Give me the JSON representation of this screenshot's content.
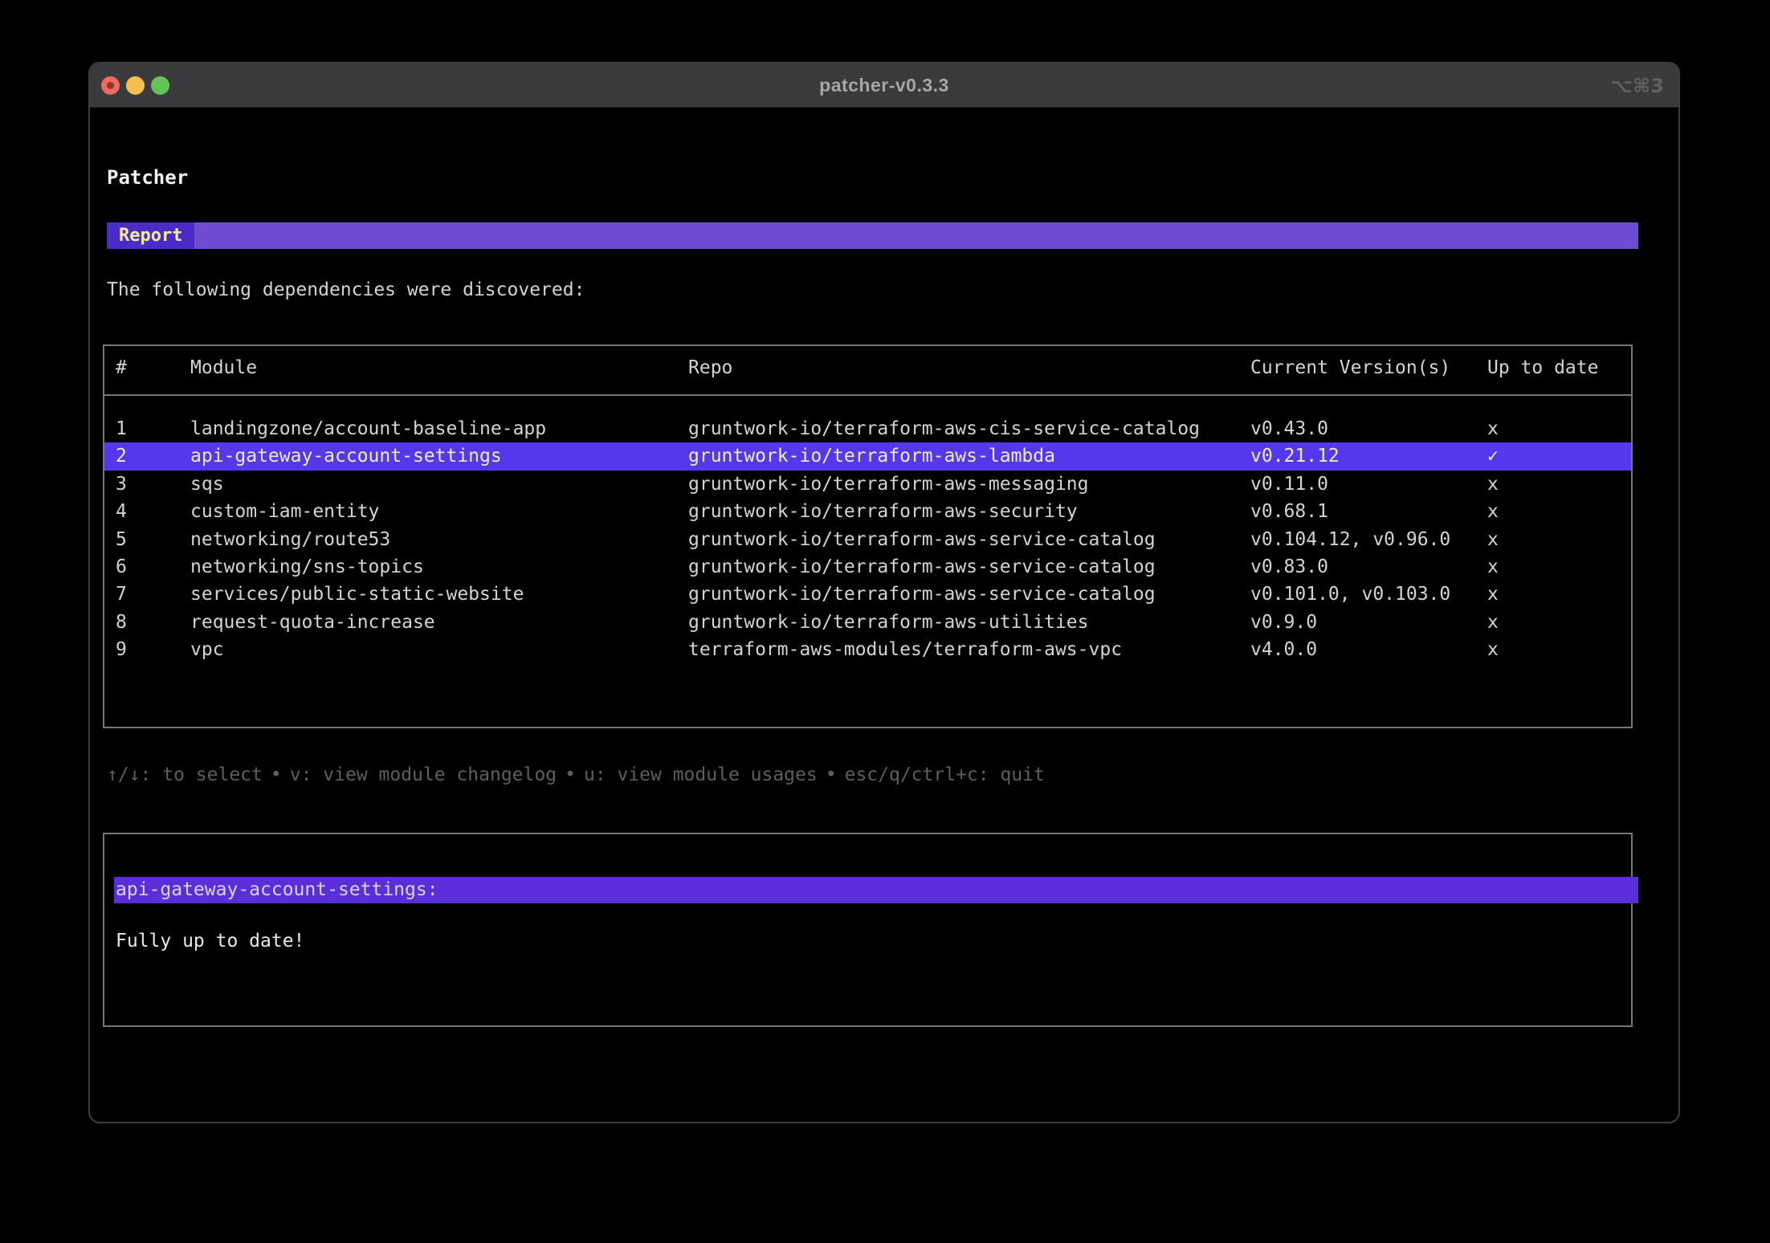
{
  "window": {
    "title": "patcher-v0.3.3",
    "shortcut": "⌥⌘3",
    "controls": [
      "close",
      "minimize",
      "zoom"
    ]
  },
  "app": {
    "heading": "Patcher",
    "active_tab": "Report",
    "intro": "The following dependencies were discovered:"
  },
  "table": {
    "columns": [
      "#",
      "Module",
      "Repo",
      "Current Version(s)",
      "Up to date"
    ],
    "rows": [
      {
        "num": "1",
        "module": "landingzone/account-baseline-app",
        "repo": "gruntwork-io/terraform-aws-cis-service-catalog",
        "versions": "v0.43.0",
        "up_to_date": "x",
        "selected": false
      },
      {
        "num": "2",
        "module": "api-gateway-account-settings",
        "repo": "gruntwork-io/terraform-aws-lambda",
        "versions": "v0.21.12",
        "up_to_date": "✓",
        "selected": true
      },
      {
        "num": "3",
        "module": "sqs",
        "repo": "gruntwork-io/terraform-aws-messaging",
        "versions": "v0.11.0",
        "up_to_date": "x",
        "selected": false
      },
      {
        "num": "4",
        "module": "custom-iam-entity",
        "repo": "gruntwork-io/terraform-aws-security",
        "versions": "v0.68.1",
        "up_to_date": "x",
        "selected": false
      },
      {
        "num": "5",
        "module": "networking/route53",
        "repo": "gruntwork-io/terraform-aws-service-catalog",
        "versions": "v0.104.12, v0.96.0",
        "up_to_date": "x",
        "selected": false
      },
      {
        "num": "6",
        "module": "networking/sns-topics",
        "repo": "gruntwork-io/terraform-aws-service-catalog",
        "versions": "v0.83.0",
        "up_to_date": "x",
        "selected": false
      },
      {
        "num": "7",
        "module": "services/public-static-website",
        "repo": "gruntwork-io/terraform-aws-service-catalog",
        "versions": "v0.101.0, v0.103.0",
        "up_to_date": "x",
        "selected": false
      },
      {
        "num": "8",
        "module": "request-quota-increase",
        "repo": "gruntwork-io/terraform-aws-utilities",
        "versions": "v0.9.0",
        "up_to_date": "x",
        "selected": false
      },
      {
        "num": "9",
        "module": "vpc",
        "repo": "terraform-aws-modules/terraform-aws-vpc",
        "versions": "v4.0.0",
        "up_to_date": "x",
        "selected": false
      }
    ]
  },
  "help": {
    "separator": "•",
    "items": [
      "↑/↓: to select",
      "v: view module changelog",
      "u: view module usages",
      "esc/q/ctrl+c: quit"
    ]
  },
  "detail": {
    "title": "api-gateway-account-settings:",
    "body": "Fully up to date!"
  },
  "colors": {
    "tab_bar": "#6f4bd4",
    "active_tab": "#4a2bc7",
    "selected_row": "#5638ec",
    "detail_highlight": "#5a2ed9",
    "selected_text": "#f0ecc2",
    "tab_text": "#f2eb9e",
    "body_text": "#d4d4d4",
    "help_text": "#5e5e5e",
    "border": "#767676",
    "titlebar": "#3a3a3c"
  }
}
